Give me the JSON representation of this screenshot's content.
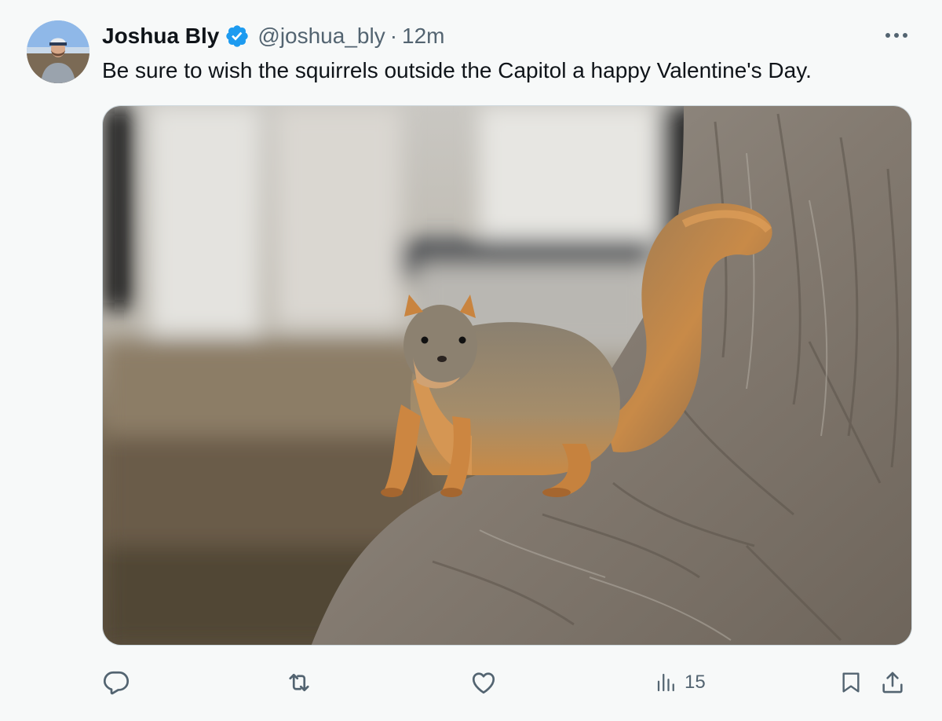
{
  "post": {
    "author": {
      "display_name": "Joshua Bly",
      "handle": "@joshua_bly",
      "verified": true,
      "avatar_icon": "avatar-photo"
    },
    "separator": "·",
    "time": "12m",
    "text": "Be sure to wish the squirrels outside the Capitol a happy Valentine's Day.",
    "media": {
      "kind": "photo",
      "subject": "squirrel-on-tree-trunk"
    },
    "actions": {
      "reply_icon": "speech-bubble-icon",
      "repost_icon": "repost-arrows-icon",
      "like_icon": "heart-icon",
      "views_icon": "bar-chart-icon",
      "views_count": "15",
      "bookmark_icon": "bookmark-icon",
      "share_icon": "share-upload-icon"
    },
    "more_icon": "ellipsis-icon"
  },
  "colors": {
    "background": "#f7f9f9",
    "text_primary": "#0f1419",
    "text_secondary": "#536471",
    "verified_blue": "#1d9bf0",
    "media_border": "#cfd9de"
  }
}
